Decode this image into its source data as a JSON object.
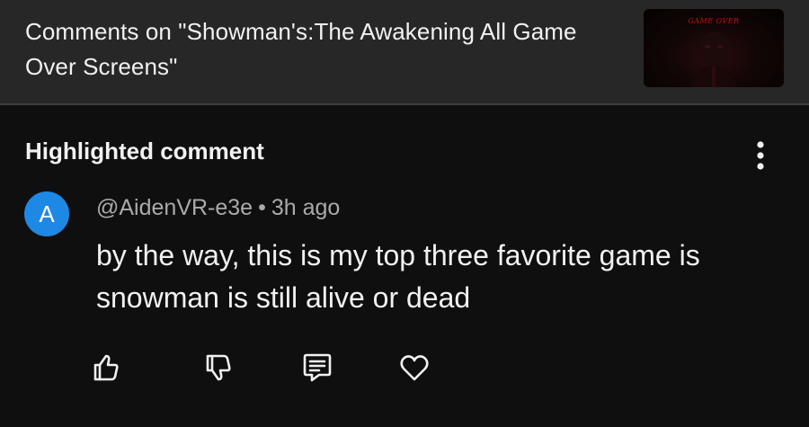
{
  "header": {
    "title": "Comments on \"Showman's:The Awakening All Game Over Screens\"",
    "thumbnail_text": "GAME OVER"
  },
  "highlighted": {
    "section_title": "Highlighted comment",
    "menu_icon": "more-vert-icon",
    "comment": {
      "avatar_letter": "A",
      "avatar_color": "#1e88e5",
      "author": "@AidenVR-e3e",
      "separator": "•",
      "time": "3h ago",
      "text": "by the way, this is my top three favorite game is snowman is still alive or dead"
    },
    "actions": [
      {
        "name": "like-icon"
      },
      {
        "name": "dislike-icon"
      },
      {
        "name": "reply-icon"
      },
      {
        "name": "heart-icon"
      }
    ]
  },
  "colors": {
    "header_bg": "#272727",
    "page_bg": "#0f0f0f",
    "text_primary": "#f1f1f1",
    "text_secondary": "#aaaaaa"
  }
}
